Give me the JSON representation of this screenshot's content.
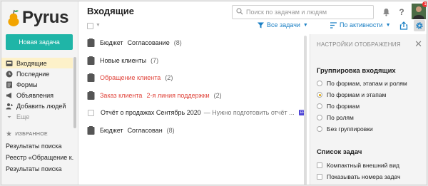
{
  "brand": {
    "name": "Pyrus"
  },
  "sidebar": {
    "new_task_label": "Новая задача",
    "items": [
      {
        "label": "Входящие",
        "icon": "inbox-icon",
        "active": true
      },
      {
        "label": "Последние",
        "icon": "clock-icon"
      },
      {
        "label": "Формы",
        "icon": "form-icon"
      },
      {
        "label": "Объявления",
        "icon": "megaphone-icon"
      },
      {
        "label": "Добавить людей",
        "icon": "add-person-icon"
      },
      {
        "label": "Еще",
        "icon": "chevron-down-icon"
      }
    ],
    "favorites_label": "ИЗБРАННОЕ",
    "favorites": [
      "Результаты поиска",
      "Реестр «Обращение к...",
      "Результаты поиска"
    ]
  },
  "header": {
    "title": "Входящие",
    "search_placeholder": "Поиск по задачам и людям",
    "notification_badge": "1"
  },
  "toolbar": {
    "filter_label": "Все задачи",
    "sort_label": "По активности"
  },
  "tasks": [
    {
      "title": "Бюджет",
      "status": "Согласование",
      "count": "(8)",
      "type": "form"
    },
    {
      "title": "Новые клиенты",
      "count": "(7)",
      "type": "form"
    },
    {
      "title": "Обращение клиента",
      "count": "(2)",
      "type": "form",
      "highlight": true
    },
    {
      "title": "Заказ клиента",
      "status": "2-я линия поддержки",
      "count": "(2)",
      "type": "form",
      "highlight": true
    },
    {
      "title": "Отчёт о продажах Сентябрь 2020",
      "snippet": "— Нужно подготовить отчёт ...",
      "tag": "EP",
      "type": "task"
    },
    {
      "title": "Бюджет",
      "status": "Согласован",
      "count": "(8)",
      "type": "form"
    }
  ],
  "panel": {
    "title": "НАСТРОЙКИ ОТОБРАЖЕНИЯ",
    "grouping_title": "Группировка входящих",
    "grouping_options": [
      "По формам, этапам и ролям",
      "По формам и этапам",
      "По формам",
      "По ролям",
      "Без группировки"
    ],
    "grouping_selected": "По формам и этапам",
    "list_title": "Список задач",
    "list_options": [
      "Компактный внешний вид",
      "Показывать номера задач"
    ]
  },
  "colors": {
    "accent": "#1fb5a7",
    "link": "#1a7fc4",
    "highlight": "#e0443b",
    "active_nav": "#fdf1c9",
    "logo_pear": "#f2a400"
  }
}
